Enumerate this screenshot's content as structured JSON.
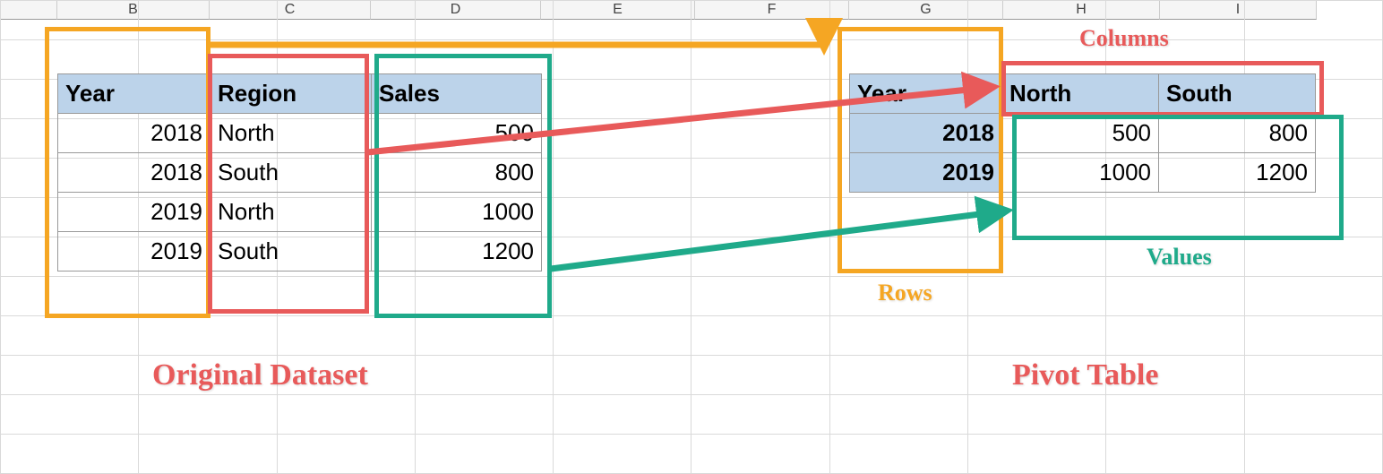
{
  "columns": [
    "B",
    "C",
    "D",
    "E",
    "F",
    "G",
    "H",
    "I"
  ],
  "source": {
    "headers": {
      "year": "Year",
      "region": "Region",
      "sales": "Sales"
    },
    "rows": [
      {
        "year": "2018",
        "region": "North",
        "sales": "500"
      },
      {
        "year": "2018",
        "region": "South",
        "sales": "800"
      },
      {
        "year": "2019",
        "region": "North",
        "sales": "1000"
      },
      {
        "year": "2019",
        "region": "South",
        "sales": "1200"
      }
    ]
  },
  "pivot": {
    "row_header": "Year",
    "col_headers": [
      "North",
      "South"
    ],
    "rows": [
      {
        "label": "2018",
        "vals": [
          "500",
          "800"
        ]
      },
      {
        "label": "2019",
        "vals": [
          "1000",
          "1200"
        ]
      }
    ]
  },
  "labels": {
    "columns": "Columns",
    "rows": "Rows",
    "values": "Values",
    "original": "Original Dataset",
    "pivot": "Pivot Table"
  }
}
